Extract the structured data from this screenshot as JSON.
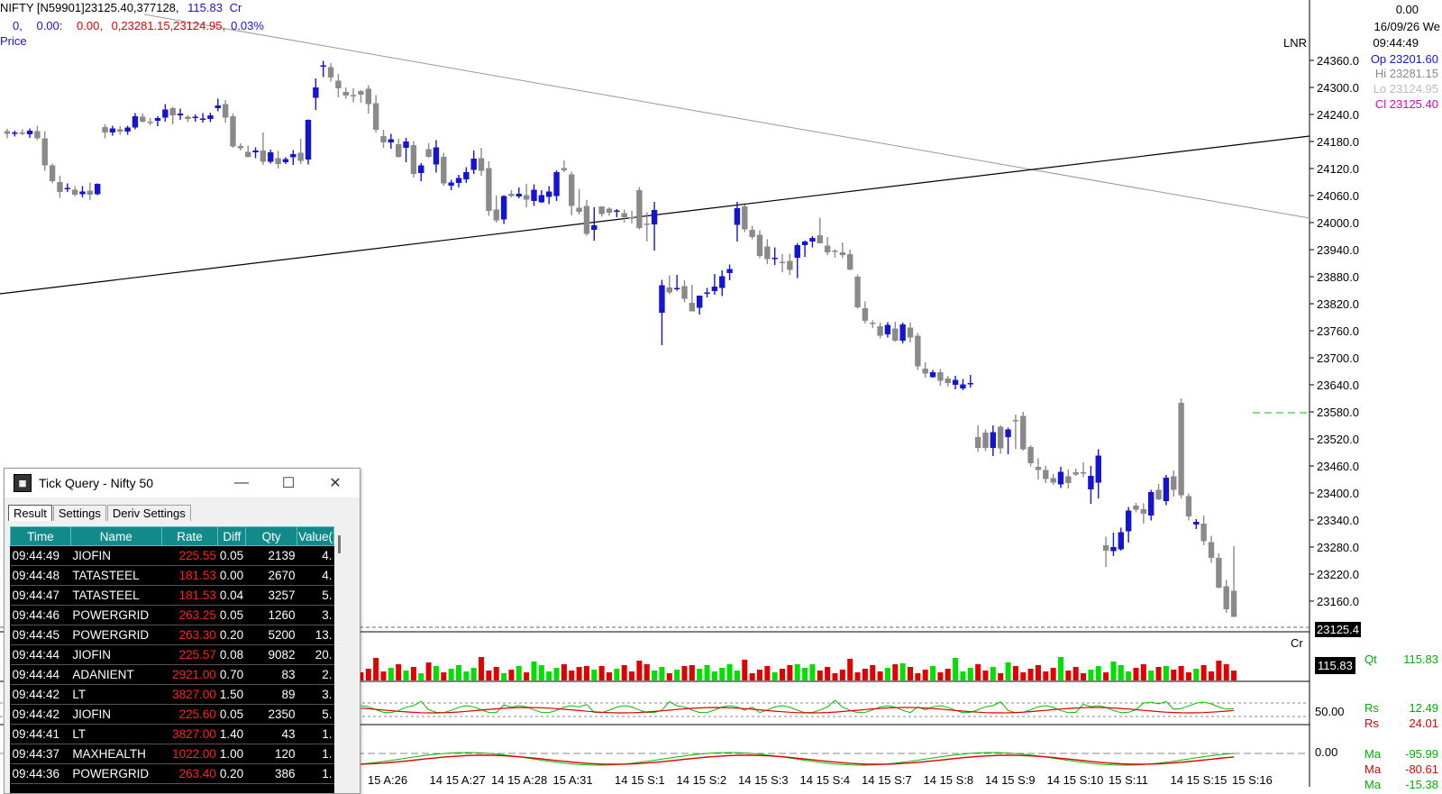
{
  "header": {
    "line1_a": "NIFTY [N59901]",
    "line1_b": "23125.40,377128,",
    "line1_c": "115.83",
    "line1_d": "Cr",
    "line2_a": "0,",
    "line2_b": "0.00:",
    "line2_c": "0.00,",
    "line2_d": "0,23281.15,23124.95,",
    "line2_e": "0.03%",
    "line3": "Price"
  },
  "right_panel": {
    "top_value": "0.00",
    "date": "16/09/26 We",
    "time": "09:44:49",
    "op": "Op 23201.60",
    "hi": "Hi  23281.15",
    "lo": "Lo  23124.95",
    "cl": "Cl  23125.40",
    "lnr": "LNR",
    "cr": "Cr",
    "qt_label": "Qt",
    "qt_value": "115.83",
    "vol_box": "115.83",
    "rs1_label": "Rs",
    "rs1_value": "12.49",
    "rs2_label": "Rs",
    "rs2_value": "24.01",
    "rsi_axis": "50.00",
    "ma_axis": "0.00",
    "ma1_label": "Ma",
    "ma1_value": "-95.99",
    "ma2_label": "Ma",
    "ma2_value": "-80.61",
    "ma3_label": "Ma",
    "ma3_value": "-15.38",
    "last_price": "23125.4"
  },
  "price_axis": [
    "24360.0",
    "24300.0",
    "24240.0",
    "24180.0",
    "24120.0",
    "24060.0",
    "24000.0",
    "23940.0",
    "23880.0",
    "23820.0",
    "23760.0",
    "23700.0",
    "23640.0",
    "23580.0",
    "23520.0",
    "23460.0",
    "23400.0",
    "23340.0",
    "23280.0",
    "23220.0",
    "23160.0"
  ],
  "time_axis": [
    "15 A:26",
    "14 15 A:27",
    "14 15 A:28",
    "15 A:31",
    "14 15 S:1",
    "14 15 S:2",
    "14 15 S:3",
    "14 15 S:4",
    "14 15 S:7",
    "14 15 S:8",
    "14 15 S:9",
    "14 15 S:10",
    "15 S:11",
    "14 15 S:15",
    "15 S:16"
  ],
  "colors": {
    "bull": "#1414d2",
    "bear": "#8a8a8a",
    "vol_up": "#00e000",
    "vol_down": "#e00000"
  },
  "candles": [
    [
      24203,
      24208,
      24187,
      24197
    ],
    [
      24197,
      24204,
      24191,
      24200
    ],
    [
      24200,
      24207,
      24194,
      24199
    ],
    [
      24196,
      24209,
      24188,
      24204
    ],
    [
      24203,
      24215,
      24183,
      24187
    ],
    [
      24187,
      24203,
      24115,
      24127
    ],
    [
      24127,
      24131,
      24087,
      24092
    ],
    [
      24090,
      24104,
      24055,
      24068
    ],
    [
      24075,
      24087,
      24068,
      24077
    ],
    [
      24073,
      24081,
      24058,
      24062
    ],
    [
      24063,
      24081,
      24056,
      24069
    ],
    [
      24071,
      24089,
      24050,
      24062
    ],
    [
      24063,
      24087,
      24061,
      24086
    ],
    [
      24212,
      24218,
      24187,
      24200
    ],
    [
      24200,
      24215,
      24193,
      24209
    ],
    [
      24207,
      24214,
      24195,
      24202
    ],
    [
      24202,
      24215,
      24195,
      24211
    ],
    [
      24211,
      24243,
      24207,
      24236
    ],
    [
      24235,
      24243,
      24222,
      24224
    ],
    [
      24224,
      24232,
      24216,
      24221
    ],
    [
      24226,
      24236,
      24214,
      24232
    ],
    [
      24233,
      24263,
      24224,
      24251
    ],
    [
      24254,
      24257,
      24218,
      24238
    ],
    [
      24238,
      24253,
      24228,
      24242
    ],
    [
      24235,
      24239,
      24223,
      24230
    ],
    [
      24232,
      24240,
      24224,
      24235
    ],
    [
      24230,
      24243,
      24222,
      24231
    ],
    [
      24230,
      24244,
      24223,
      24238
    ],
    [
      24254,
      24275,
      24247,
      24260
    ],
    [
      24263,
      24272,
      24222,
      24233
    ],
    [
      24236,
      24242,
      24166,
      24169
    ],
    [
      24170,
      24176,
      24160,
      24165
    ],
    [
      24157,
      24171,
      24144,
      24146
    ],
    [
      24156,
      24167,
      24143,
      24160
    ],
    [
      24160,
      24200,
      24128,
      24135
    ],
    [
      24135,
      24162,
      24131,
      24156
    ],
    [
      24143,
      24159,
      24120,
      24130
    ],
    [
      24134,
      24145,
      24130,
      24141
    ],
    [
      24145,
      24161,
      24128,
      24152
    ],
    [
      24155,
      24186,
      24130,
      24137
    ],
    [
      24140,
      24229,
      24129,
      24228
    ],
    [
      24277,
      24320,
      24250,
      24300
    ],
    [
      24349,
      24359,
      24323,
      24349
    ],
    [
      24345,
      24354,
      24313,
      24322
    ],
    [
      24315,
      24330,
      24278,
      24298
    ],
    [
      24290,
      24300,
      24275,
      24282
    ],
    [
      24283,
      24298,
      24267,
      24280
    ],
    [
      24292,
      24294,
      24266,
      24284
    ],
    [
      24297,
      24305,
      24242,
      24263
    ],
    [
      24265,
      24283,
      24200,
      24206
    ],
    [
      24192,
      24206,
      24166,
      24178
    ],
    [
      24178,
      24197,
      24164,
      24185
    ],
    [
      24174,
      24186,
      24144,
      24146
    ],
    [
      24166,
      24188,
      24134,
      24180
    ],
    [
      24172,
      24181,
      24100,
      24108
    ],
    [
      24110,
      24132,
      24092,
      24127
    ],
    [
      24163,
      24176,
      24144,
      24146
    ],
    [
      24129,
      24183,
      24111,
      24167
    ],
    [
      24146,
      24155,
      24082,
      24087
    ],
    [
      24082,
      24095,
      24072,
      24089
    ],
    [
      24088,
      24106,
      24078,
      24099
    ],
    [
      24096,
      24123,
      24088,
      24112
    ],
    [
      24117,
      24160,
      24108,
      24142
    ],
    [
      24143,
      24166,
      24104,
      24115
    ],
    [
      24121,
      24136,
      24015,
      24026
    ],
    [
      24029,
      24060,
      24000,
      24005
    ],
    [
      24007,
      24061,
      23997,
      24059
    ],
    [
      24064,
      24072,
      24056,
      24059
    ],
    [
      24058,
      24078,
      24054,
      24064
    ],
    [
      24061,
      24086,
      24034,
      24051
    ],
    [
      24048,
      24085,
      24037,
      24073
    ],
    [
      24045,
      24072,
      24044,
      24061
    ],
    [
      24057,
      24081,
      24041,
      24069
    ],
    [
      24059,
      24116,
      24048,
      24112
    ],
    [
      24121,
      24138,
      24112,
      24116
    ],
    [
      24107,
      24113,
      24016,
      24037
    ],
    [
      24033,
      24075,
      24018,
      24024
    ],
    [
      24037,
      24050,
      23971,
      23975
    ],
    [
      23984,
      24034,
      23960,
      23994
    ],
    [
      24036,
      24032,
      24013,
      24019
    ],
    [
      24031,
      24034,
      24015,
      24022
    ],
    [
      24024,
      24030,
      24012,
      24027
    ],
    [
      24021,
      24029,
      24000,
      24012
    ],
    [
      24012,
      24026,
      23998,
      24011
    ],
    [
      24072,
      24079,
      23985,
      23988
    ],
    [
      23998,
      24023,
      23958,
      23995
    ],
    [
      23996,
      24046,
      23938,
      24028
    ],
    [
      23800,
      23873,
      23728,
      23861
    ],
    [
      23856,
      23883,
      23841,
      23845
    ],
    [
      23852,
      23884,
      23849,
      23855
    ],
    [
      23859,
      23872,
      23823,
      23831
    ],
    [
      23822,
      23862,
      23804,
      23803
    ],
    [
      23811,
      23830,
      23796,
      23838
    ],
    [
      23842,
      23855,
      23834,
      23845
    ],
    [
      23848,
      23886,
      23840,
      23858
    ],
    [
      23855,
      23894,
      23837,
      23881
    ],
    [
      23888,
      23907,
      23872,
      23897
    ],
    [
      23995,
      24046,
      23958,
      24032
    ],
    [
      24036,
      24040,
      23979,
      23985
    ],
    [
      23984,
      23993,
      23963,
      23968
    ],
    [
      23973,
      23983,
      23921,
      23926
    ],
    [
      23947,
      23963,
      23908,
      23919
    ],
    [
      23922,
      23945,
      23906,
      23922
    ],
    [
      23913,
      23930,
      23890,
      23910
    ],
    [
      23915,
      23931,
      23884,
      23895
    ],
    [
      23922,
      23954,
      23877,
      23950
    ],
    [
      23950,
      23960,
      23924,
      23958
    ],
    [
      23958,
      23970,
      23945,
      23966
    ],
    [
      23972,
      24011,
      23954,
      23954
    ],
    [
      23949,
      23968,
      23928,
      23934
    ],
    [
      23938,
      23941,
      23922,
      23937
    ],
    [
      23934,
      23956,
      23921,
      23928
    ],
    [
      23930,
      23940,
      23894,
      23896
    ],
    [
      23880,
      23885,
      23809,
      23812
    ],
    [
      23810,
      23825,
      23776,
      23782
    ],
    [
      23778,
      23783,
      23766,
      23775
    ],
    [
      23770,
      23778,
      23743,
      23749
    ],
    [
      23752,
      23779,
      23745,
      23773
    ],
    [
      23765,
      23780,
      23736,
      23738
    ],
    [
      23738,
      23778,
      23732,
      23774
    ],
    [
      23767,
      23778,
      23734,
      23745
    ],
    [
      23749,
      23755,
      23673,
      23681
    ],
    [
      23676,
      23690,
      23656,
      23665
    ],
    [
      23657,
      23673,
      23656,
      23668
    ],
    [
      23668,
      23675,
      23638,
      23649
    ],
    [
      23654,
      23660,
      23636,
      23644
    ],
    [
      23640,
      23660,
      23630,
      23651
    ],
    [
      23632,
      23653,
      23628,
      23641
    ],
    [
      23643,
      23662,
      23634,
      23644
    ],
    [
      23524,
      23550,
      23491,
      23500
    ],
    [
      23534,
      23541,
      23493,
      23500
    ],
    [
      23500,
      23550,
      23482,
      23535
    ],
    [
      23547,
      23550,
      23487,
      23499
    ],
    [
      23524,
      23545,
      23486,
      23541
    ],
    [
      23562,
      23574,
      23497,
      23560
    ],
    [
      23571,
      23580,
      23494,
      23497
    ],
    [
      23502,
      23506,
      23459,
      23466
    ],
    [
      23458,
      23477,
      23430,
      23451
    ],
    [
      23451,
      23460,
      23422,
      23431
    ],
    [
      23433,
      23442,
      23418,
      23423
    ],
    [
      23419,
      23458,
      23411,
      23447
    ],
    [
      23437,
      23452,
      23410,
      23422
    ],
    [
      23446,
      23454,
      23438,
      23441
    ],
    [
      23446,
      23468,
      23435,
      23443
    ],
    [
      23408,
      23460,
      23376,
      23438
    ],
    [
      23423,
      23497,
      23388,
      23483
    ],
    [
      23284,
      23303,
      23236,
      23272
    ],
    [
      23271,
      23312,
      23260,
      23280
    ],
    [
      23275,
      23323,
      23272,
      23313
    ],
    [
      23315,
      23369,
      23290,
      23361
    ],
    [
      23372,
      23378,
      23357,
      23363
    ],
    [
      23364,
      23377,
      23332,
      23354
    ],
    [
      23350,
      23407,
      23339,
      23402
    ],
    [
      23407,
      23420,
      23384,
      23386
    ],
    [
      23382,
      23440,
      23373,
      23434
    ],
    [
      23437,
      23450,
      23392,
      23407
    ],
    [
      23600,
      23610,
      23388,
      23395
    ],
    [
      23393,
      23399,
      23339,
      23348
    ],
    [
      23330,
      23342,
      23320,
      23336
    ],
    [
      23332,
      23350,
      23284,
      23293
    ],
    [
      23291,
      23305,
      23245,
      23256
    ],
    [
      23256,
      23266,
      23188,
      23190
    ],
    [
      23193,
      23207,
      23134,
      23142
    ],
    [
      23183,
      23282,
      23125,
      23125
    ]
  ],
  "tick_query": {
    "title": "Tick Query - Nifty 50",
    "tabs": [
      "Result",
      "Settings",
      "Deriv Settings"
    ],
    "columns": [
      "Time",
      "Name",
      "Rate",
      "Diff",
      "Qty",
      "Value("
    ],
    "rows": [
      [
        "09:44:49",
        "JIOFIN",
        "225.55",
        "0.05",
        "2139",
        "4."
      ],
      [
        "09:44:48",
        "TATASTEEL",
        "181.53",
        "0.00",
        "2670",
        "4."
      ],
      [
        "09:44:47",
        "TATASTEEL",
        "181.53",
        "0.04",
        "3257",
        "5."
      ],
      [
        "09:44:46",
        "POWERGRID",
        "263.25",
        "0.05",
        "1260",
        "3."
      ],
      [
        "09:44:45",
        "POWERGRID",
        "263.30",
        "0.20",
        "5200",
        "13."
      ],
      [
        "09:44:44",
        "JIOFIN",
        "225.57",
        "0.08",
        "9082",
        "20."
      ],
      [
        "09:44:44",
        "ADANIENT",
        "2921.00",
        "0.70",
        "83",
        "2."
      ],
      [
        "09:44:42",
        "LT",
        "3827.00",
        "1.50",
        "89",
        "3."
      ],
      [
        "09:44:42",
        "JIOFIN",
        "225.60",
        "0.05",
        "2350",
        "5."
      ],
      [
        "09:44:41",
        "LT",
        "3827.00",
        "1.40",
        "43",
        "1."
      ],
      [
        "09:44:37",
        "MAXHEALTH",
        "1022.00",
        "1.00",
        "120",
        "1."
      ],
      [
        "09:44:36",
        "POWERGRID",
        "263.40",
        "0.20",
        "386",
        "1."
      ]
    ]
  }
}
